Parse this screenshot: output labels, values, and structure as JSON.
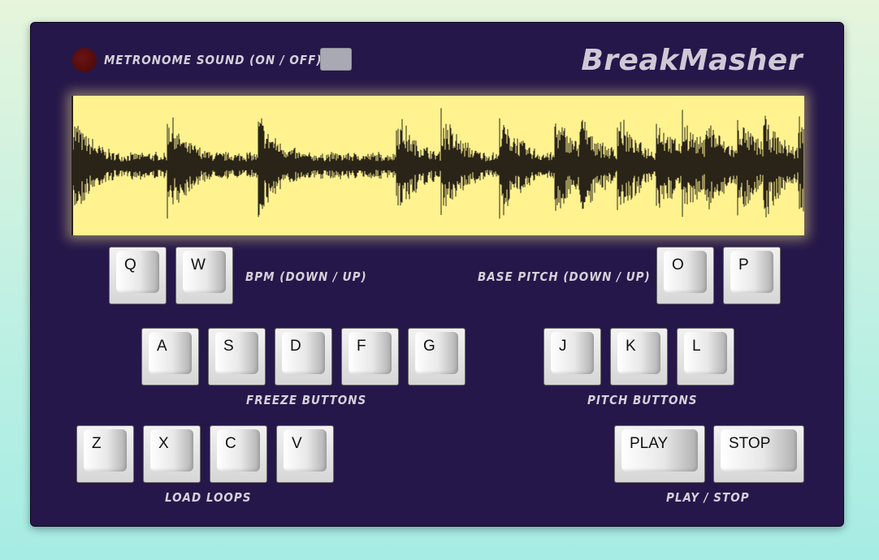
{
  "app": {
    "title": "BreakMasher"
  },
  "metronome": {
    "label": "METRONOME SOUND (ON / OFF)"
  },
  "colors": {
    "panel": "#26174a",
    "waveform_bg": "#fff28f",
    "waveform_fg": "#2a2418",
    "led_off": "#4e0b0b",
    "label_text": "#d4d1da"
  },
  "bpm": {
    "label": "BPM (DOWN / UP)",
    "keys": [
      "Q",
      "W"
    ]
  },
  "base_pitch": {
    "label": "BASE PITCH (DOWN / UP)",
    "keys": [
      "O",
      "P"
    ]
  },
  "freeze": {
    "label": "FREEZE BUTTONS",
    "keys": [
      "A",
      "S",
      "D",
      "F",
      "G"
    ]
  },
  "pitch": {
    "label": "PITCH BUTTONS",
    "keys": [
      "J",
      "K",
      "L"
    ]
  },
  "loops": {
    "label": "LOAD LOOPS",
    "keys": [
      "Z",
      "X",
      "C",
      "V"
    ]
  },
  "transport": {
    "label": "PLAY / STOP",
    "keys": [
      "PLAY",
      "STOP"
    ]
  }
}
